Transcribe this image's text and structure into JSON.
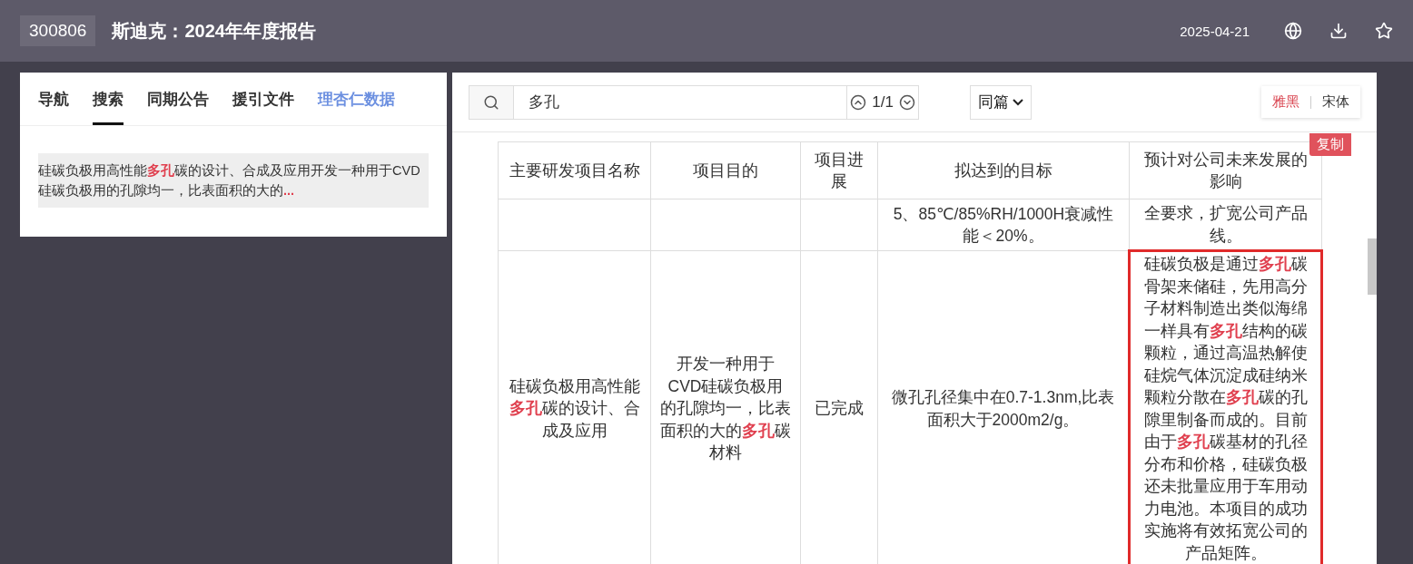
{
  "header": {
    "code": "300806",
    "title": "斯迪克：2024年年度报告",
    "date": "2025-04-21"
  },
  "side_tabs": [
    {
      "label": "导航",
      "selected": false,
      "kind": "tab"
    },
    {
      "label": "搜索",
      "selected": true,
      "kind": "tab"
    },
    {
      "label": "同期公告",
      "selected": false,
      "kind": "tab"
    },
    {
      "label": "援引文件",
      "selected": false,
      "kind": "tab"
    },
    {
      "label": "理杏仁数据",
      "selected": false,
      "kind": "link"
    }
  ],
  "search_results": [
    {
      "text": "硅碳负极用高性能**多孔**碳的设计、合成及应用开发一种用于CVD硅碳负极用的孔隙均一，比表面积的大的",
      "more": "..."
    }
  ],
  "search": {
    "value": "多孔",
    "counter": "1/1",
    "scope": "同篇"
  },
  "font_options": [
    {
      "label": "雅黑",
      "selected": true
    },
    {
      "label": "宋体",
      "selected": false
    }
  ],
  "copy_button": "复制",
  "table": {
    "columns": [
      "主要研发项目名称",
      "项目目的",
      "项目进展",
      "拟达到的目标",
      "预计对公司未来发展的影响"
    ],
    "rows": [
      {
        "cells": [
          {
            "highlighted": false
          },
          {
            "highlighted": false
          },
          {
            "highlighted": false
          },
          {
            "text": "5、85℃/85%RH/1000H衰减性能＜20%。",
            "highlighted": false
          },
          {
            "text": "全要求，扩宽公司产品线。",
            "highlighted": false
          }
        ]
      },
      {
        "cells": [
          {
            "text": "硅碳负极用高性能**多孔**碳的设计、合成及应用",
            "highlighted": false
          },
          {
            "text": "开发一种用于CVD硅碳负极用的孔隙均一，比表面积的大的**多孔**碳材料",
            "highlighted": false
          },
          {
            "text": "已完成",
            "highlighted": false
          },
          {
            "text": "微孔孔径集中在0.7-1.3nm,比表面积大于2000m2/g。",
            "highlighted": false
          },
          {
            "text": "硅碳负极是通过**多孔**碳骨架来储硅，先用高分子材料制造出类似海绵一样具有**多孔**结构的碳颗粒，通过高温热解使硅烷气体沉淀成硅纳米颗粒分散在**多孔**碳的孔隙里制备而成的。目前由于**多孔**碳基材的孔径分布和价格，硅碳负极还未批量应用于车用动力电池。本项目的成功实施将有效拓宽公司的产品矩阵。",
            "highlighted": true
          }
        ]
      }
    ]
  }
}
